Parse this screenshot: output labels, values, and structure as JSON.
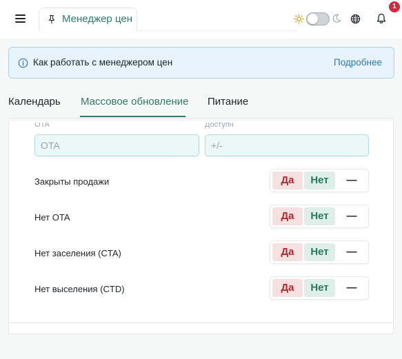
{
  "header": {
    "page_tab_label": "Менеджер цен",
    "notification_count": "1"
  },
  "info_banner": {
    "text": "Как работать с менеджером цен",
    "link": "Подробнее"
  },
  "tabs": [
    {
      "label": "Календарь",
      "active": false
    },
    {
      "label": "Массовое обновление",
      "active": true
    },
    {
      "label": "Питание",
      "active": false
    }
  ],
  "form": {
    "cut_label_left": "OTA",
    "cut_label_right": "Доступн",
    "ota_input": {
      "value": "",
      "placeholder": "OTA"
    },
    "availability_input": {
      "value": "",
      "placeholder": "+/-"
    },
    "rows": [
      {
        "label": "Закрыты продажи",
        "yes": "Да",
        "no": "Нет",
        "none": "—"
      },
      {
        "label": "Нет OTA",
        "yes": "Да",
        "no": "Нет",
        "none": "—"
      },
      {
        "label": "Нет заселения (CTA)",
        "yes": "Да",
        "no": "Нет",
        "none": "—"
      },
      {
        "label": "Нет выселения (CTD)",
        "yes": "Да",
        "no": "Нет",
        "none": "—"
      }
    ]
  },
  "colors": {
    "accent": "#2c7a6b",
    "info_bg": "#e6f3fb",
    "info_link": "#2d79b5",
    "yes_bg": "#f6e1e1",
    "yes_text": "#b3262f",
    "no_bg": "#dfeee9",
    "no_text": "#247a5e",
    "badge": "#d8263b"
  },
  "icons": [
    "menu-icon",
    "pin-icon",
    "sun-icon",
    "moon-icon",
    "globe-icon",
    "bell-icon",
    "info-icon"
  ]
}
